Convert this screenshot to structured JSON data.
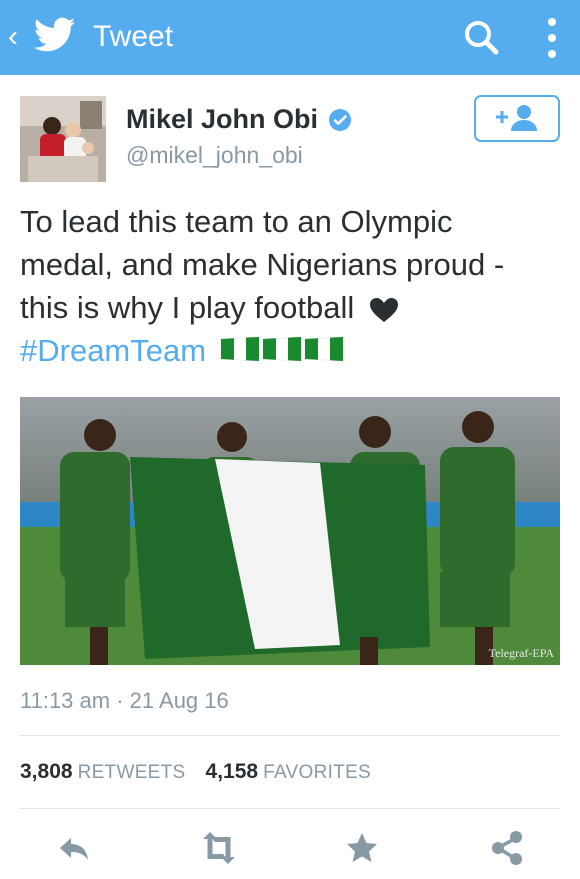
{
  "app": {
    "title": "Tweet",
    "colors": {
      "bar": "#55acee",
      "text": "#292f33",
      "muted": "#8899a6",
      "link": "#55acee",
      "action_icon": "#8899a6"
    },
    "icons": [
      "back-chevron-icon",
      "twitter-bird-icon",
      "search-icon",
      "more-vertical-icon"
    ]
  },
  "author": {
    "name": "Mikel John Obi",
    "handle": "@mikel_john_obi",
    "verified": true
  },
  "tweet": {
    "text_lines": [
      "To lead this team to an Olympic",
      "medal, and make Nigerians proud -",
      "this is why I play football"
    ],
    "hashtag": "#DreamTeam",
    "emoji": [
      "heart",
      "nigeria-flag",
      "nigeria-flag",
      "nigeria-flag"
    ],
    "media_credit": "Telegraf-EPA",
    "timestamp": "11:13 am · 21 Aug 16"
  },
  "stats": {
    "retweets": "3,808",
    "retweets_label": "RETWEETS",
    "favorites": "4,158",
    "favorites_label": "FAVORITES"
  },
  "actions": [
    "reply-icon",
    "retweet-icon",
    "favorite-star-icon",
    "share-icon"
  ]
}
